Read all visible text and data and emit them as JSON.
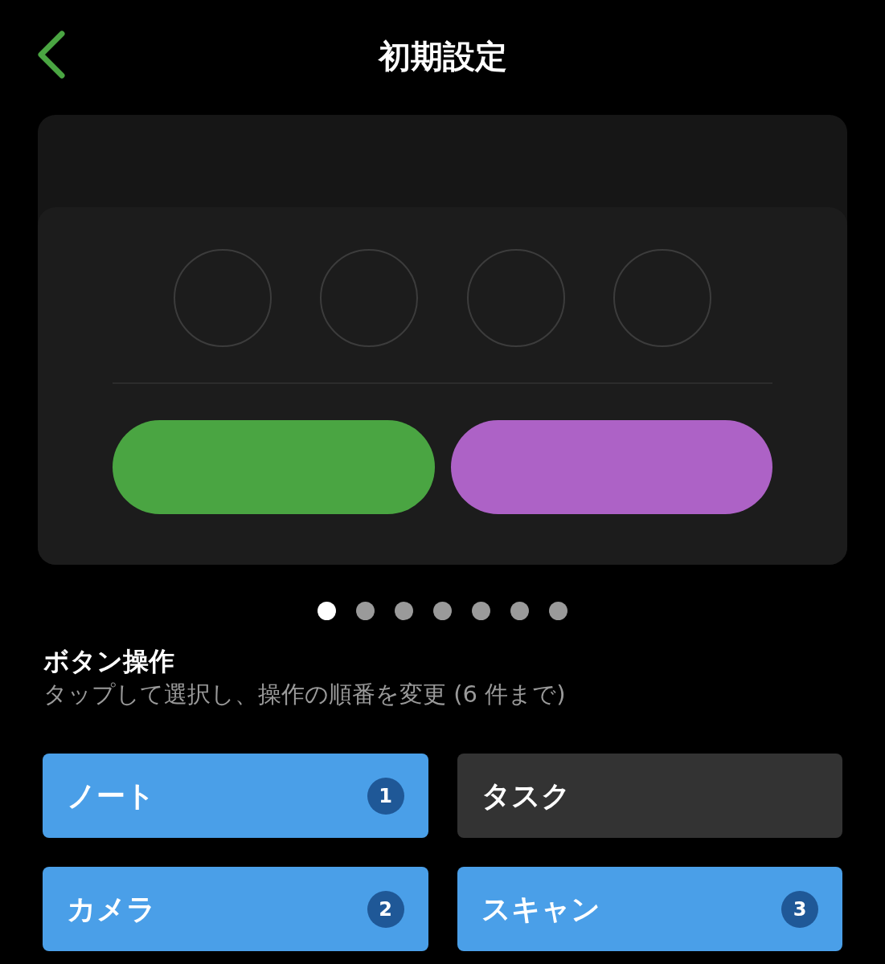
{
  "header": {
    "title": "初期設定"
  },
  "pager": [
    {
      "selected": true
    },
    {
      "selected": false
    },
    {
      "selected": false
    },
    {
      "selected": false
    },
    {
      "selected": false
    },
    {
      "selected": false
    },
    {
      "selected": false
    }
  ],
  "section": {
    "title": "ボタン操作",
    "subtitle": "タップして選択し、操作の順番を変更 (6 件まで)"
  },
  "options": [
    {
      "label": "ノート",
      "selected": true,
      "order": "1"
    },
    {
      "label": "タスク",
      "selected": false
    },
    {
      "label": "カメラ",
      "selected": true,
      "order": "2"
    },
    {
      "label": "スキャン",
      "selected": true,
      "order": "3"
    }
  ]
}
